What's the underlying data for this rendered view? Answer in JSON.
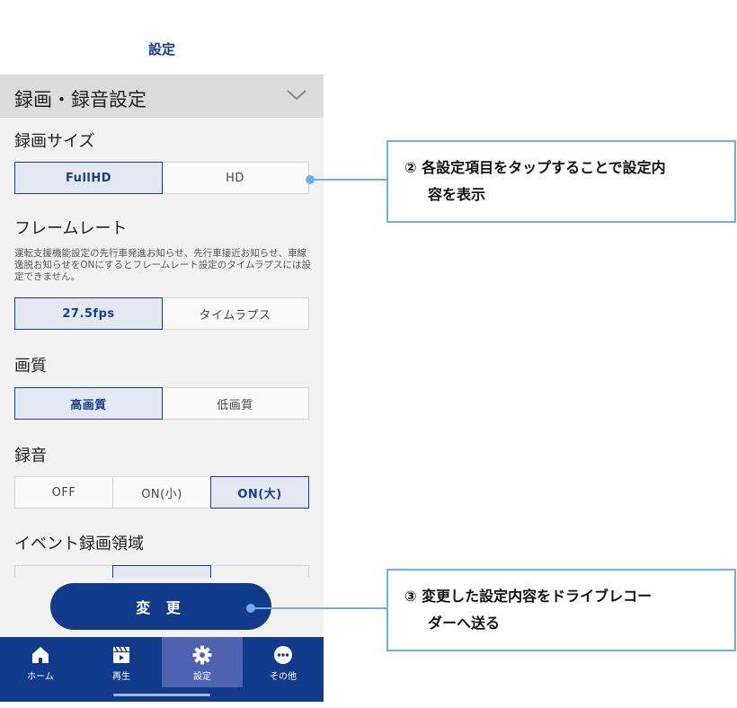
{
  "header": {
    "title": "設定"
  },
  "section": {
    "title": "録画・録音設定"
  },
  "video_size": {
    "label": "録画サイズ",
    "options": [
      "FullHD",
      "HD"
    ],
    "selected": "FullHD"
  },
  "frame_rate": {
    "label": "フレームレート",
    "note": "運転支援機能設定の先行車発進お知らせ、先行車接近お知らせ、車線逸脱お知らせをONにするとフレームレート設定のタイムラプスには設定できません。",
    "options": [
      "27.5fps",
      "タイムラプス"
    ],
    "selected": "27.5fps"
  },
  "quality": {
    "label": "画質",
    "options": [
      "高画質",
      "低画質"
    ],
    "selected": "高画質"
  },
  "audio": {
    "label": "録音",
    "options": [
      "OFF",
      "ON(小)",
      "ON(大)"
    ],
    "selected": "ON(大)"
  },
  "event_area": {
    "label": "イベント録画領域"
  },
  "apply_button": {
    "label": "変 更"
  },
  "tabs": [
    {
      "label": "ホーム",
      "icon": "home-icon"
    },
    {
      "label": "再生",
      "icon": "clapperboard-icon"
    },
    {
      "label": "設定",
      "icon": "gear-icon",
      "active": true
    },
    {
      "label": "その他",
      "icon": "more-icon"
    }
  ],
  "annotations": {
    "callout2": {
      "line1": "② 各設定項目をタップすることで設定内",
      "line2": "容を表示"
    },
    "callout3": {
      "line1": "③ 変更した設定内容をドライブレコー",
      "line2": "ダーへ送る"
    }
  },
  "colors": {
    "brand": "#123a8a",
    "accent_line": "#6fb0ea",
    "selected_bg": "#e3e8f2",
    "tab_active": "#4d62b0"
  }
}
